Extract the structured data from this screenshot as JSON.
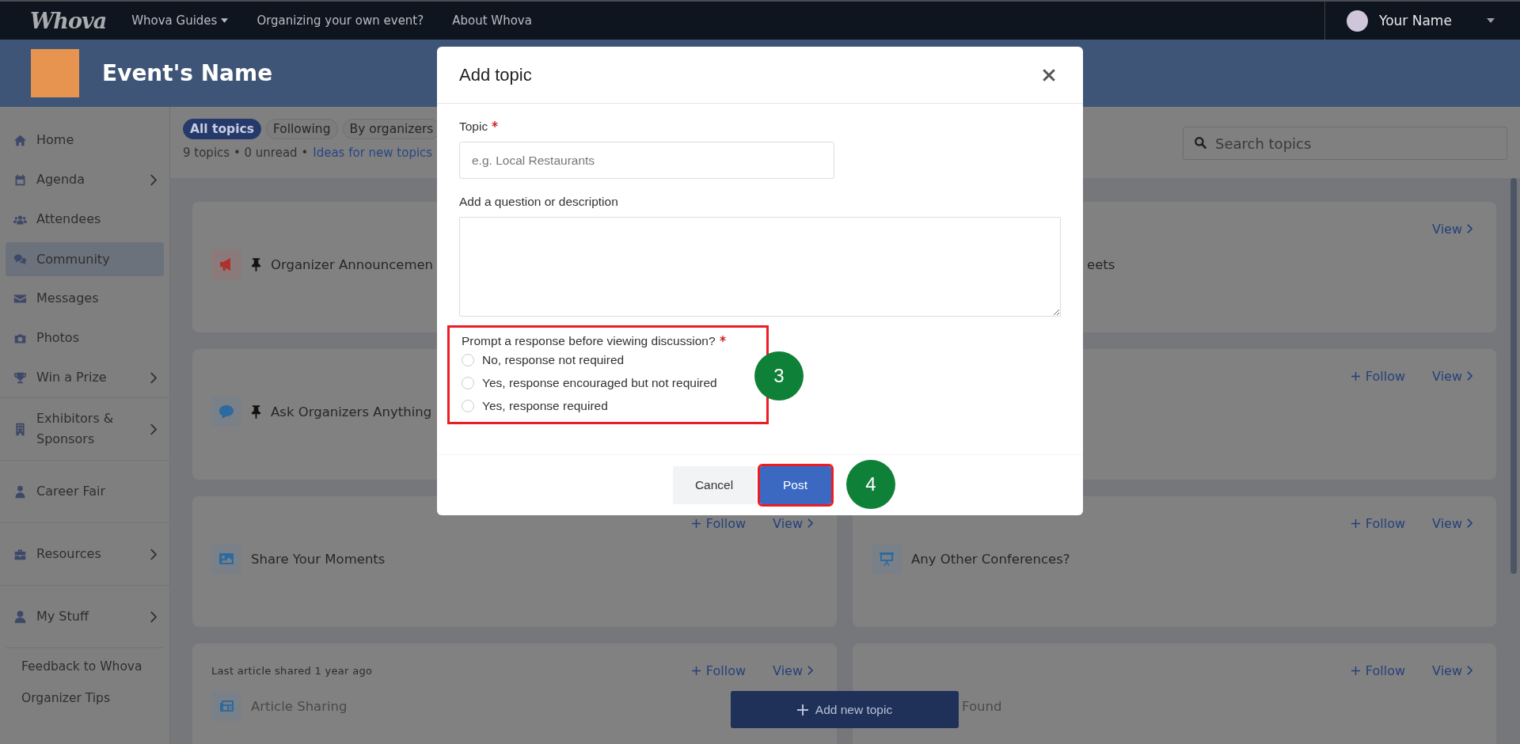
{
  "topbar": {
    "logo": "Whova",
    "links": [
      {
        "label": "Whova Guides",
        "dropdown": true
      },
      {
        "label": "Organizing your own event?",
        "dropdown": false
      },
      {
        "label": "About Whova",
        "dropdown": false
      }
    ],
    "user": {
      "name": "Your Name"
    }
  },
  "banner": {
    "title": "Event's Name"
  },
  "sidebar": {
    "items": [
      {
        "kind": "nav",
        "label": "Home",
        "submenu": false,
        "selected": false
      },
      {
        "kind": "nav",
        "label": "Agenda",
        "submenu": true,
        "selected": false
      },
      {
        "kind": "nav",
        "label": "Attendees",
        "submenu": false,
        "selected": false
      },
      {
        "kind": "nav",
        "label": "Community",
        "submenu": false,
        "selected": true
      },
      {
        "kind": "nav",
        "label": "Messages",
        "submenu": false,
        "selected": false
      },
      {
        "kind": "nav",
        "label": "Photos",
        "submenu": false,
        "selected": false
      },
      {
        "kind": "nav",
        "label": "Win a Prize",
        "submenu": true,
        "selected": false
      },
      {
        "kind": "section",
        "label": "Exhibitors & Sponsors",
        "submenu": true,
        "selected": false
      },
      {
        "kind": "section",
        "label": "Career Fair",
        "submenu": false,
        "selected": false
      },
      {
        "kind": "section",
        "label": "Resources",
        "submenu": true,
        "selected": false
      },
      {
        "kind": "section",
        "label": "My Stuff",
        "submenu": true,
        "selected": false
      },
      {
        "kind": "link",
        "label": "Feedback to Whova"
      },
      {
        "kind": "link",
        "label": "Organizer Tips"
      }
    ]
  },
  "filters": {
    "tabs": [
      {
        "label": "All topics",
        "selected": true
      },
      {
        "label": "Following",
        "selected": false
      },
      {
        "label": "By organizers",
        "selected": false
      }
    ],
    "summary": "9 topics • 0 unread •",
    "ideas_link": "Ideas for new topics",
    "search": {
      "placeholder": "Search topics"
    }
  },
  "topics": [
    {
      "kind": "full",
      "pinned": true,
      "title": "Organizer Announcemen"
    },
    {
      "kind": "under-dialog",
      "title": "eets",
      "view": "View"
    },
    {
      "kind": "full",
      "pinned": true,
      "title": "Ask Organizers Anything"
    },
    {
      "kind": "under-dialog",
      "follow": "Follow",
      "view": "View"
    },
    {
      "kind": "full",
      "pinned": false,
      "title": "Share Your Moments",
      "follow": "Follow",
      "view": "View"
    },
    {
      "kind": "full",
      "pinned": false,
      "title": "Any Other Conferences?",
      "follow": "Follow",
      "view": "View"
    },
    {
      "kind": "full",
      "pinned": false,
      "note": "Last article shared 1 year ago",
      "title": "Article Sharing",
      "follow": "Follow",
      "view": "View"
    },
    {
      "kind": "under-button",
      "title": "Found",
      "follow": "Follow",
      "view": "View"
    }
  ],
  "add_button": {
    "label": "Add new topic"
  },
  "dialog": {
    "title": "Add topic",
    "topic": {
      "label": "Topic",
      "required": true,
      "placeholder": "e.g. Local Restaurants"
    },
    "description": {
      "label": "Add a question or description"
    },
    "prompt": {
      "label": "Prompt a response before viewing discussion?",
      "required": true,
      "highlighted": true,
      "options": [
        {
          "label": "No, response not required",
          "selected": false
        },
        {
          "label": "Yes, response encouraged but not required",
          "selected": false
        },
        {
          "label": "Yes, response required",
          "selected": false
        }
      ]
    },
    "buttons": [
      {
        "kind": "secondary",
        "label": "Cancel",
        "highlighted": false
      },
      {
        "kind": "primary",
        "label": "Post",
        "highlighted": true
      }
    ]
  },
  "annotations": [
    {
      "label": "3"
    },
    {
      "label": "4"
    }
  ]
}
